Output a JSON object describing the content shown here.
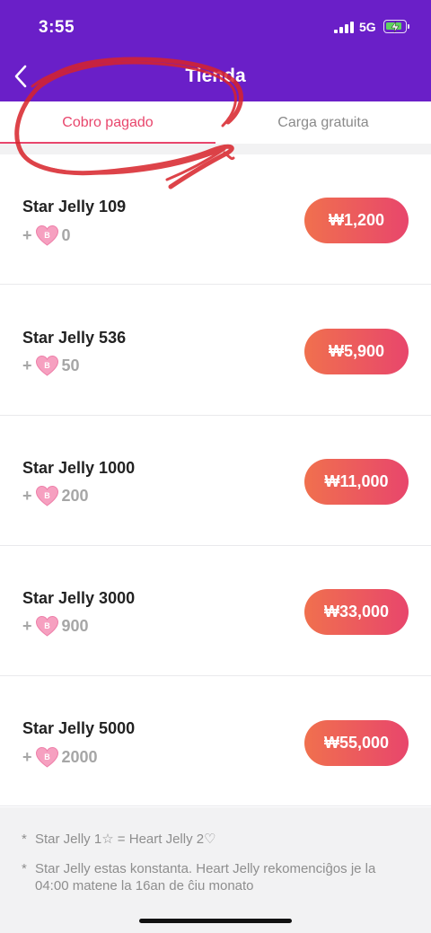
{
  "status_bar": {
    "time": "3:55",
    "network": "5G"
  },
  "header": {
    "title": "Tienda"
  },
  "tabs": [
    {
      "label": "Cobro pagado",
      "active": true
    },
    {
      "label": "Carga gratuita",
      "active": false
    }
  ],
  "products": [
    {
      "name": "Star Jelly 109",
      "bonus_prefix": "+",
      "bonus_value": "0",
      "price": "₩1,200"
    },
    {
      "name": "Star Jelly 536",
      "bonus_prefix": "+",
      "bonus_value": "50",
      "price": "₩5,900"
    },
    {
      "name": "Star Jelly 1000",
      "bonus_prefix": "+",
      "bonus_value": "200",
      "price": "₩11,000"
    },
    {
      "name": "Star Jelly 3000",
      "bonus_prefix": "+",
      "bonus_value": "900",
      "price": "₩33,000"
    },
    {
      "name": "Star Jelly 5000",
      "bonus_prefix": "+",
      "bonus_value": "2000",
      "price": "₩55,000"
    }
  ],
  "heart_badge_letter": "B",
  "notes": [
    {
      "bullet": "*",
      "text": "Star Jelly 1☆ = Heart Jelly 2♡"
    },
    {
      "bullet": "*",
      "text": "Star Jelly estas konstanta. Heart Jelly rekomenciĝos je la 04:00 matene la 16an de ĉiu monato"
    }
  ],
  "colors": {
    "header_bg": "#6a1fc8",
    "accent": "#e8466c",
    "price_gradient_start": "#f0704e",
    "price_gradient_end": "#e8466c",
    "annotation_red": "#d8232a"
  },
  "icons": {
    "back": "chevron-left-icon",
    "signal": "signal-icon",
    "battery": "battery-charging-icon",
    "bonus": "heart-jelly-icon"
  }
}
